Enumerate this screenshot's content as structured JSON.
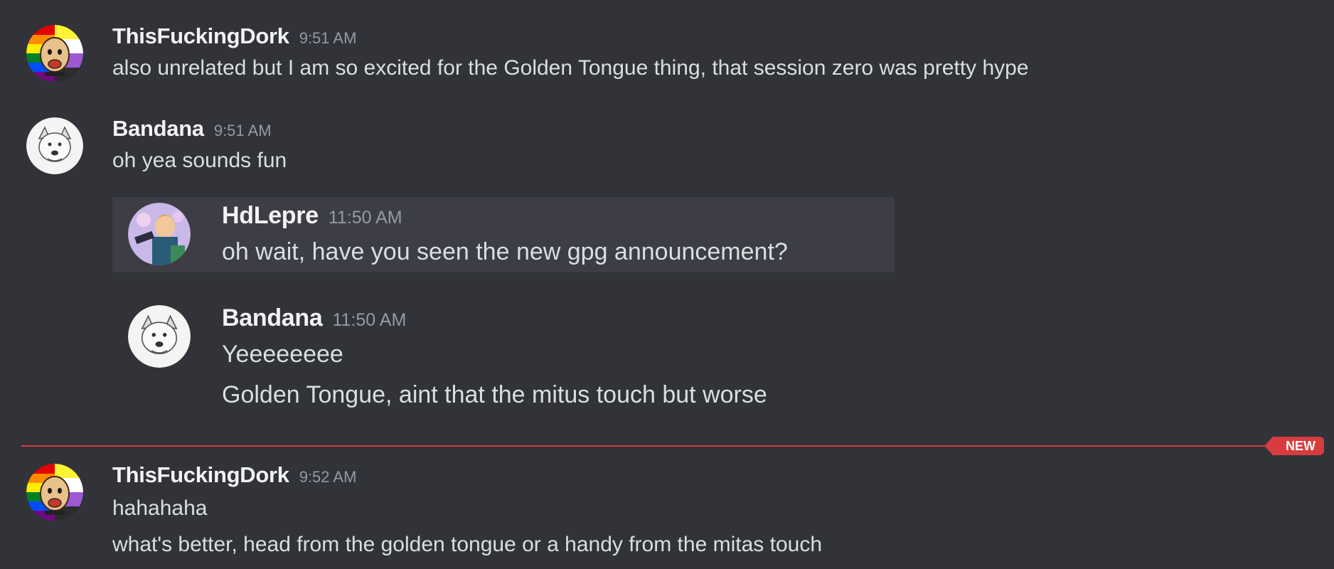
{
  "messages": [
    {
      "username": "ThisFuckingDork",
      "timestamp": "9:51 AM",
      "avatar_icon": "pride-dog-avatar-icon",
      "lines": [
        "also unrelated but I am so excited for the Golden Tongue thing, that session zero was pretty hype"
      ]
    },
    {
      "username": "Bandana",
      "timestamp": "9:51 AM",
      "avatar_icon": "sketch-dog-avatar-icon",
      "lines": [
        "oh yea sounds fun"
      ]
    },
    {
      "username": "HdLepre",
      "timestamp": "11:50 AM",
      "avatar_icon": "character-art-avatar-icon",
      "lines": [
        "oh wait, have you seen the new gpg announcement?"
      ]
    },
    {
      "username": "Bandana",
      "timestamp": "11:50 AM",
      "avatar_icon": "sketch-dog-avatar-icon",
      "lines": [
        "Yeeeeeeee",
        "Golden Tongue, aint that the mitus touch but worse"
      ]
    },
    {
      "username": "ThisFuckingDork",
      "timestamp": "9:52 AM",
      "avatar_icon": "pride-dog-avatar-icon",
      "lines": [
        "hahahaha",
        "what's better, head from the golden tongue or a handy from the mitas touch"
      ]
    }
  ],
  "divider": {
    "label": "NEW",
    "color": "#d83c3e"
  },
  "colors": {
    "background": "#313338",
    "highlight": "#3c3d45",
    "username": "#f2f3f5",
    "timestamp": "#949ba4",
    "text": "#dbdee1"
  }
}
